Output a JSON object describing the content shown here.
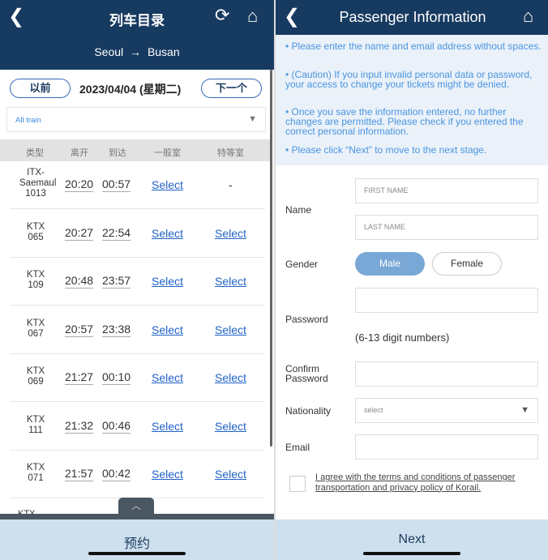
{
  "left": {
    "title": "列车目录",
    "route": {
      "from": "Seoul",
      "to": "Busan"
    },
    "prev_label": "以前",
    "next_label": "下一个",
    "date": "2023/04/04 (星期二)",
    "filter": "All train",
    "columns": [
      "类型",
      "离开",
      "到达",
      "一般室",
      "特等室"
    ],
    "rows": [
      {
        "type": "ITX-Saemaul 1013",
        "depart": "20:20",
        "arrive": "00:57",
        "general": "Select",
        "first": "-"
      },
      {
        "type": "KTX 065",
        "depart": "20:27",
        "arrive": "22:54",
        "general": "Select",
        "first": "Select"
      },
      {
        "type": "KTX 109",
        "depart": "20:48",
        "arrive": "23:57",
        "general": "Select",
        "first": "Select"
      },
      {
        "type": "KTX 067",
        "depart": "20:57",
        "arrive": "23:38",
        "general": "Select",
        "first": "Select"
      },
      {
        "type": "KTX 069",
        "depart": "21:27",
        "arrive": "00:10",
        "general": "Select",
        "first": "Select"
      },
      {
        "type": "KTX 111",
        "depart": "21:32",
        "arrive": "00:46",
        "general": "Select",
        "first": "Select"
      },
      {
        "type": "KTX 071",
        "depart": "21:57",
        "arrive": "00:42",
        "general": "Select",
        "first": "Select"
      }
    ],
    "partial_row": "KTX",
    "reserve_label": "预约"
  },
  "right": {
    "title": "Passenger Information",
    "notes": [
      "• Please enter the name and email address without spaces.",
      "• (Caution) If you input invalid personal data or password, your access to change your tickets might be denied.",
      "• Once you save the information entered, no further changes are permitted. Please check if you entered the correct personal information.",
      "• Please click “Next” to move to the next stage."
    ],
    "name_label": "Name",
    "first_placeholder": "FIRST NAME",
    "last_placeholder": "LAST NAME",
    "gender_label": "Gender",
    "male": "Male",
    "female": "Female",
    "password_label": "Password",
    "password_hint": "(6-13 digit numbers)",
    "confirm_label": "Confirm Password",
    "nationality_label": "Nationality",
    "nationality_value": "select",
    "email_label": "Email",
    "agree_text": "I agree with the terms and conditions of passenger transportation and privacy policy of Korail.",
    "next_label": "Next"
  },
  "colors": {
    "header": "#173a60",
    "link": "#2062c9",
    "note": "#4a95e0",
    "male_selected": "#7aa8d6",
    "bottom": "#cedfed"
  }
}
